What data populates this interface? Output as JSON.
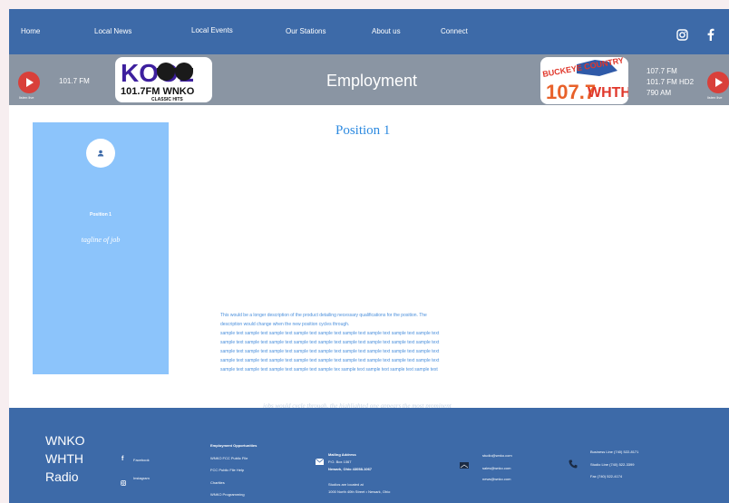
{
  "nav": {
    "items": [
      "Home",
      "Local News",
      "Local Events",
      "Our Stations",
      "About us",
      "Connect"
    ],
    "social": [
      "instagram-icon",
      "facebook-icon"
    ]
  },
  "stations": {
    "left_listen": "listen live",
    "left_freq": "101.7 FM",
    "kool_logo": {
      "line1": "KOOL",
      "line2": "101.7FM WNKO",
      "line3": "CLASSIC HITS"
    },
    "page_title": "Employment",
    "buckeye_logo": {
      "line1": "BUCKEYE COUNTRY",
      "line2": "107.7",
      "line3": "WHTH"
    },
    "right_freqs": [
      "107.7 FM",
      "101.7 FM HD2",
      "790 AM"
    ],
    "right_listen": "listen live"
  },
  "card": {
    "name": "Position 1",
    "tagline": "tagline of job"
  },
  "main": {
    "position_title": "Position 1",
    "description": [
      "This would be a longer description of the product detailing necessary qualifications for the position. The",
      "description would change when the new position cycles through.",
      "sample text sample text sample text sample text sample text sample text sample text sample text sample text",
      "sample text sample text sample text sample text sample text sample text sample text sample text sample text",
      "sample text  sample text sample text sample text sample text sample text sample text sample text sample text",
      "sample text sample text sample text sample text sample text sample text sample text  sample text sample text",
      "sample text sample text sample text sample text  sample tex sample text sample text sample text  sample text"
    ],
    "cycle_note": "jobs would cycle through, the highlighted one appears the most prominent"
  },
  "footer": {
    "brand": [
      "WNKO",
      "WHTH",
      "Radio"
    ],
    "social": [
      "Facebook",
      "Instagram"
    ],
    "links": [
      "Employment Opportunities",
      "WNKO FCC Public File",
      "FCC Public File Help",
      "Charities",
      "WNKO Programming"
    ],
    "mailing": {
      "title": "Mailing Address",
      "line1": "P.O. Box 1067",
      "line2": "Newark, Ohio 43058-1067",
      "located": "Studios are located at",
      "street": "1000 North 40th Street • Newark, Ohio"
    },
    "emails": [
      "studio@wnko.com",
      "sales@wnko.com",
      "news@wnko.com"
    ],
    "phones": [
      "Business Line (740) 522-8171",
      "Studio Line (740) 522-3399",
      "Fax (740) 522-4174"
    ]
  }
}
